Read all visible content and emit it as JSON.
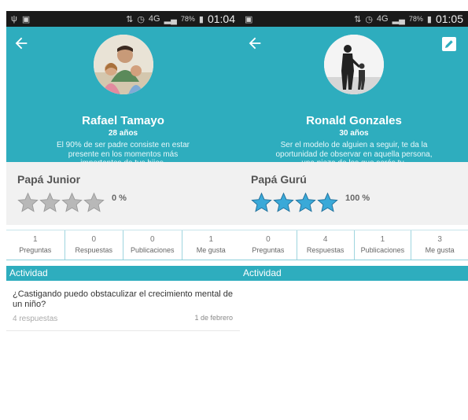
{
  "colors": {
    "accent": "#2eadbe",
    "star_active": "#3aa9d8",
    "star_inactive": "#b8b8b8"
  },
  "status_left": {
    "icons": [
      "usb-icon",
      "image-icon"
    ],
    "signal": "4G",
    "battery": "78%",
    "time": "01:04"
  },
  "status_right": {
    "icons": [
      "image-icon"
    ],
    "signal": "4G",
    "battery": "78%",
    "time": "01:05"
  },
  "left_profile": {
    "name": "Rafael Tamayo",
    "age": "28 años",
    "quote": "El 90% de ser padre consiste en estar presente en los momentos más importantes de tus hijos.",
    "level": "Papá Junior",
    "rating": 0,
    "percent": "0 %",
    "stats": [
      {
        "value": "1",
        "label": "Preguntas"
      },
      {
        "value": "0",
        "label": "Respuestas"
      },
      {
        "value": "0",
        "label": "Publicaciones"
      },
      {
        "value": "1",
        "label": "Me gusta"
      }
    ],
    "activity_title": "Actividad",
    "activity": [
      {
        "question": "¿Castigando puedo obstaculizar el crecimiento mental de un niño?",
        "answers": "4 respuestas",
        "date": "1 de febrero"
      }
    ]
  },
  "right_profile": {
    "name": "Ronald Gonzales",
    "age": "30 años",
    "quote": "Ser el modelo de alguien a seguir, te da la oportunidad de observar en aquella persona, una pieza de los que serás tu.",
    "level": "Papá Gurú",
    "rating": 4,
    "percent": "100 %",
    "stats": [
      {
        "value": "0",
        "label": "Preguntas"
      },
      {
        "value": "4",
        "label": "Respuestas"
      },
      {
        "value": "1",
        "label": "Publicaciones"
      },
      {
        "value": "3",
        "label": "Me gusta"
      }
    ],
    "activity_title": "Actividad"
  }
}
